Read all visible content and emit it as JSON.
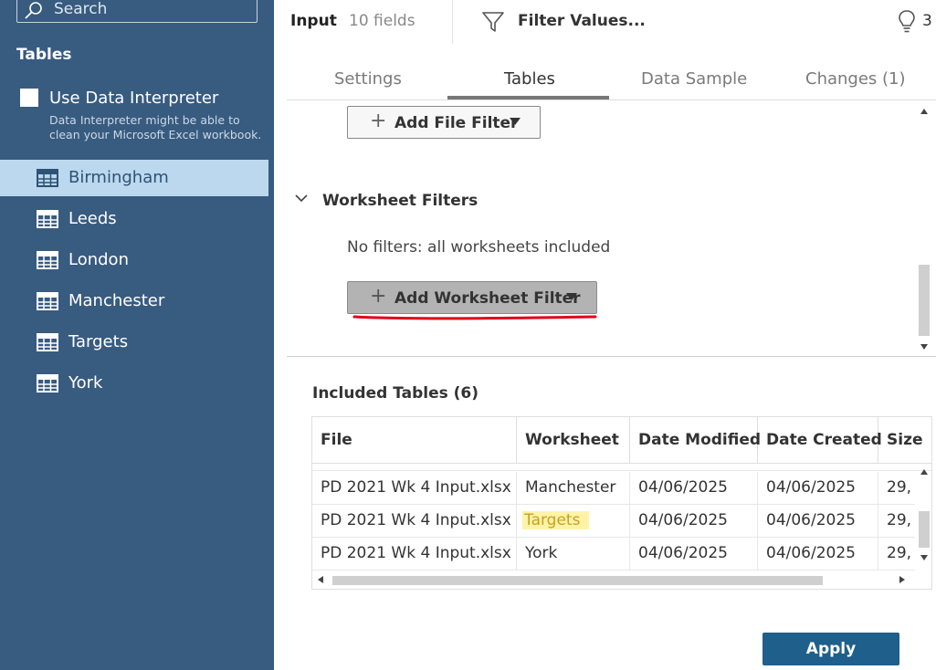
{
  "sidebar": {
    "search": {
      "placeholder": "Search"
    },
    "heading": "Tables",
    "data_interpreter": {
      "label": "Use Data Interpreter",
      "checked": false,
      "description": "Data Interpreter might be able to clean your Microsoft Excel workbook."
    },
    "tables": [
      {
        "name": "Birmingham",
        "selected": true
      },
      {
        "name": "Leeds",
        "selected": false
      },
      {
        "name": "London",
        "selected": false
      },
      {
        "name": "Manchester",
        "selected": false
      },
      {
        "name": "Targets",
        "selected": false
      },
      {
        "name": "York",
        "selected": false
      }
    ]
  },
  "topbar": {
    "title": "Input",
    "fields": "10 fields",
    "filter_label": "Filter Values...",
    "recommendations_count": "3"
  },
  "tabs": [
    {
      "label": "Settings",
      "active": false
    },
    {
      "label": "Tables",
      "active": true
    },
    {
      "label": "Data Sample",
      "active": false
    },
    {
      "label": "Changes (1)",
      "active": false
    }
  ],
  "filters": {
    "add_file_filter": "Add File Filter",
    "worksheet_heading": "Worksheet Filters",
    "no_filters_text": "No filters: all worksheets included",
    "add_worksheet_filter": "Add Worksheet Filter"
  },
  "included": {
    "heading": "Included Tables (6)",
    "columns": [
      "File",
      "Worksheet",
      "Date Modified",
      "Date Created",
      "Size"
    ],
    "rows": [
      {
        "file": "PD 2021 Wk 4 Input.xlsx",
        "worksheet": "Manchester",
        "modified": "04/06/2025",
        "created": "04/06/2025",
        "size": "29,",
        "highlight": false
      },
      {
        "file": "PD 2021 Wk 4 Input.xlsx",
        "worksheet": "Targets",
        "modified": "04/06/2025",
        "created": "04/06/2025",
        "size": "29,",
        "highlight": true
      },
      {
        "file": "PD 2021 Wk 4 Input.xlsx",
        "worksheet": "York",
        "modified": "04/06/2025",
        "created": "04/06/2025",
        "size": "29,",
        "highlight": false
      }
    ]
  },
  "apply_label": "Apply",
  "colors": {
    "sidebar_bg": "#385b80",
    "selected_bg": "#bcd8ee",
    "apply_bg": "#1f5f8b",
    "highlight": "#fff3a8",
    "annotation_red": "#e0001b"
  }
}
